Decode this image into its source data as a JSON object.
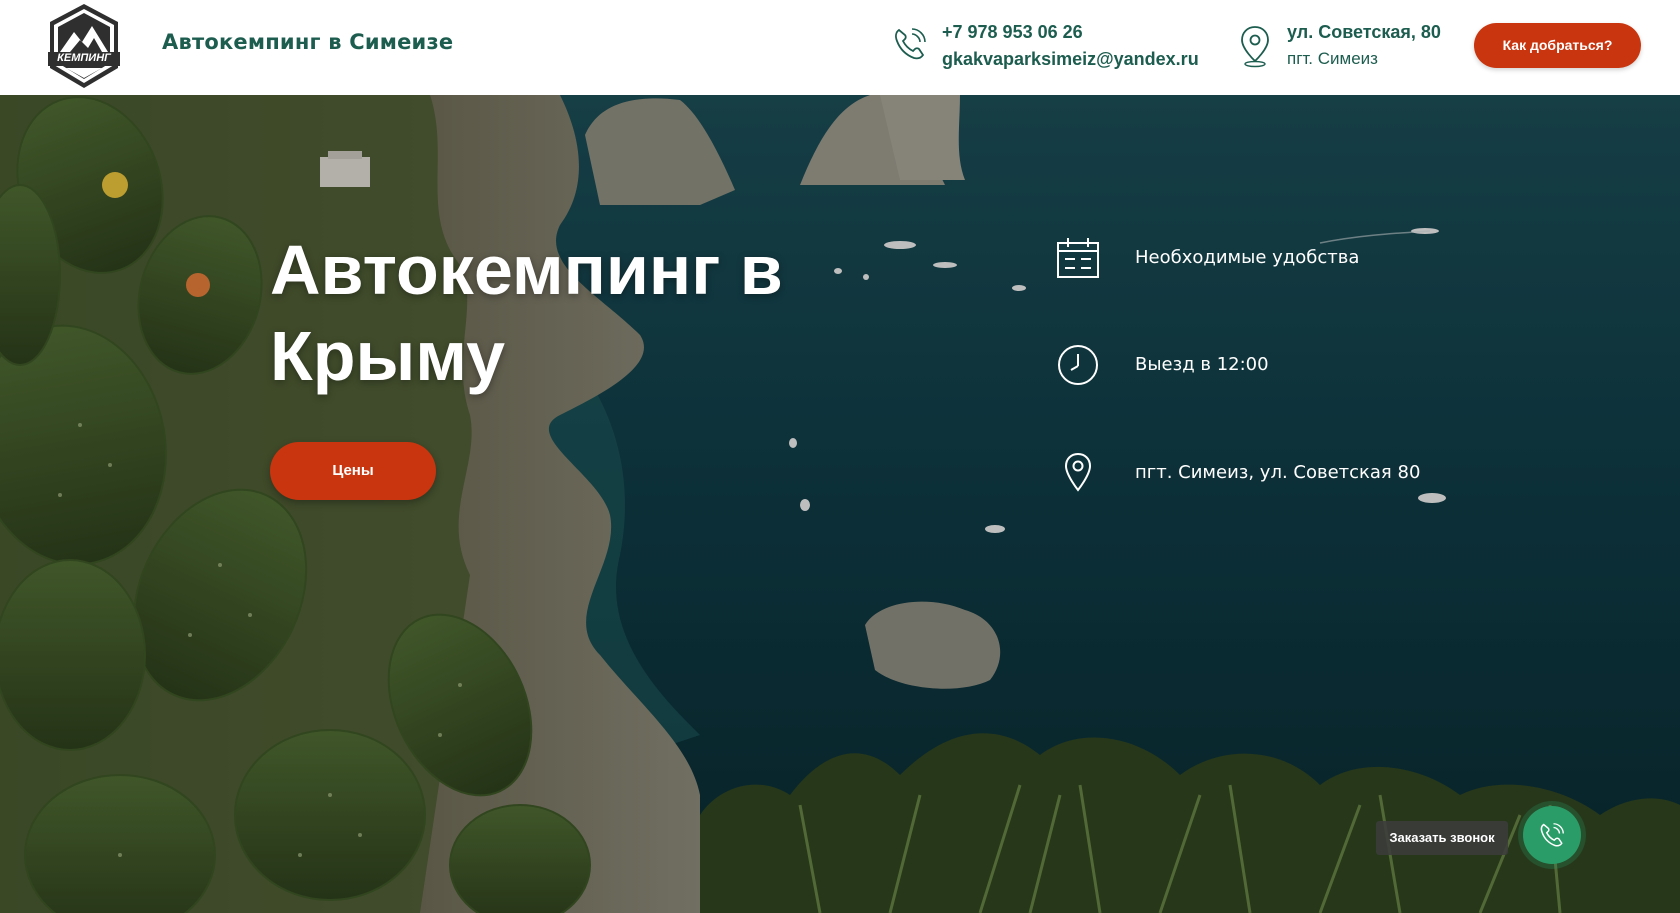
{
  "header": {
    "logo_text": "КЕМПИНГ",
    "brand_title": "Автокемпинг в Симеизе",
    "phone": "+7 978 953 06 26",
    "email": "gkakvaparksimeiz@yandex.ru",
    "address_street": "ул. Советская, 80",
    "address_town": "пгт. Симеиз",
    "howto_button": "Как добраться?",
    "phone_icon": "phone-icon",
    "pin_icon": "map-pin-icon"
  },
  "hero": {
    "title": "Автокемпинг в Крыму",
    "prices_button": "Цены",
    "features": [
      {
        "icon": "calendar-icon",
        "text": "Необходимые удобства"
      },
      {
        "icon": "clock-icon",
        "text": "Выезд в 12:00"
      },
      {
        "icon": "map-pin-icon",
        "text": "пгт. Симеиз, ул. Советская 80"
      }
    ]
  },
  "callback": {
    "label": "Заказать звонок",
    "icon": "phone-icon"
  },
  "colors": {
    "brand_green": "#1d5d4f",
    "accent_orange": "#c8350e",
    "callback_green": "#2a9c67"
  }
}
